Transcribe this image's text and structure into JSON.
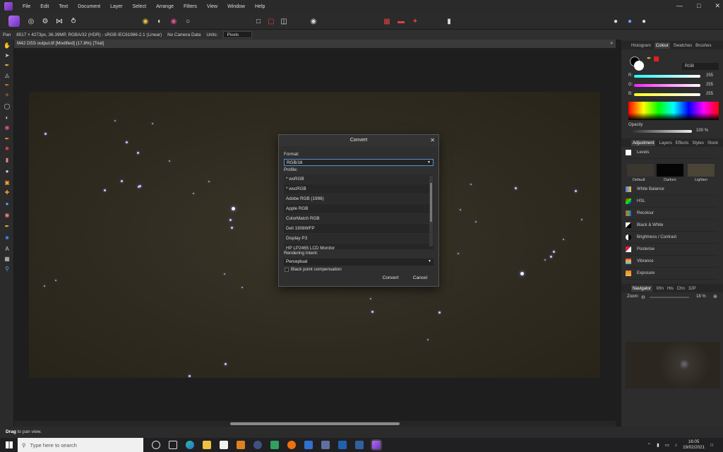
{
  "menu": [
    "File",
    "Edit",
    "Text",
    "Document",
    "Layer",
    "Select",
    "Arrange",
    "Filters",
    "View",
    "Window",
    "Help"
  ],
  "context_bar": {
    "tool": "Pan",
    "doc_info": "8517 × 4273px, 36.39MP, RGBA/32 (HDR) - sRGB IEC61966-2.1 (Linear)",
    "camera": "No Camera Data",
    "units_label": "Units:",
    "units_value": "Pixels"
  },
  "document_tab": {
    "title": "M42 DSS output.tif [Modified] (17.8%) [Trial]",
    "close": "×"
  },
  "status": {
    "bold": "Drag",
    "text": " to pan view."
  },
  "panel": {
    "top_tabs": [
      "Histogram",
      "Colour",
      "Swatches",
      "Brushes"
    ],
    "colour_mode": "RGB",
    "channels": [
      {
        "label": "R:",
        "value": "255"
      },
      {
        "label": "G:",
        "value": "255"
      },
      {
        "label": "B:",
        "value": "255"
      }
    ],
    "opacity_label": "Opacity",
    "opacity_value": "100 %",
    "mid_tabs": [
      "Adjustment",
      "Layers",
      "Effects",
      "Styles",
      "Stock"
    ],
    "levels_label": "Levels",
    "presets": [
      "Default",
      "Darken",
      "Lighten"
    ],
    "adjustments": [
      "White Balance",
      "HSL",
      "Recolour",
      "Black & White",
      "Brightness / Contrast",
      "Posterise",
      "Vibrance",
      "Exposure"
    ],
    "nav_tabs": [
      "Navigator",
      "Xfm",
      "His",
      "Chn",
      "32P"
    ],
    "zoom_label": "Zoom:",
    "zoom_value": "18 %"
  },
  "dialog": {
    "title": "Convert",
    "format_label": "Format:",
    "format_value": "RGB/16",
    "profile_label": "Profile:",
    "profiles": [
      "* wsRGB",
      "* wscRGB",
      "Adobe RGB (1998)",
      "Apple RGB",
      "ColorMatch RGB",
      "Dell 1908WFP",
      "Display P3",
      "HP LP2465 LCD Monitor"
    ],
    "intent_label": "Rendering Intent:",
    "intent_value": "Perceptual",
    "bpc_label": "Black point compensation",
    "convert": "Convert",
    "cancel": "Cancel"
  },
  "taskbar": {
    "search_placeholder": "Type here to search",
    "time": "16:05",
    "date": "19/02/2021"
  },
  "colors": {
    "accent": "#7a3fd0",
    "dialog_bg": "#2f2f2f",
    "app_bg": "#1e1e1e"
  }
}
